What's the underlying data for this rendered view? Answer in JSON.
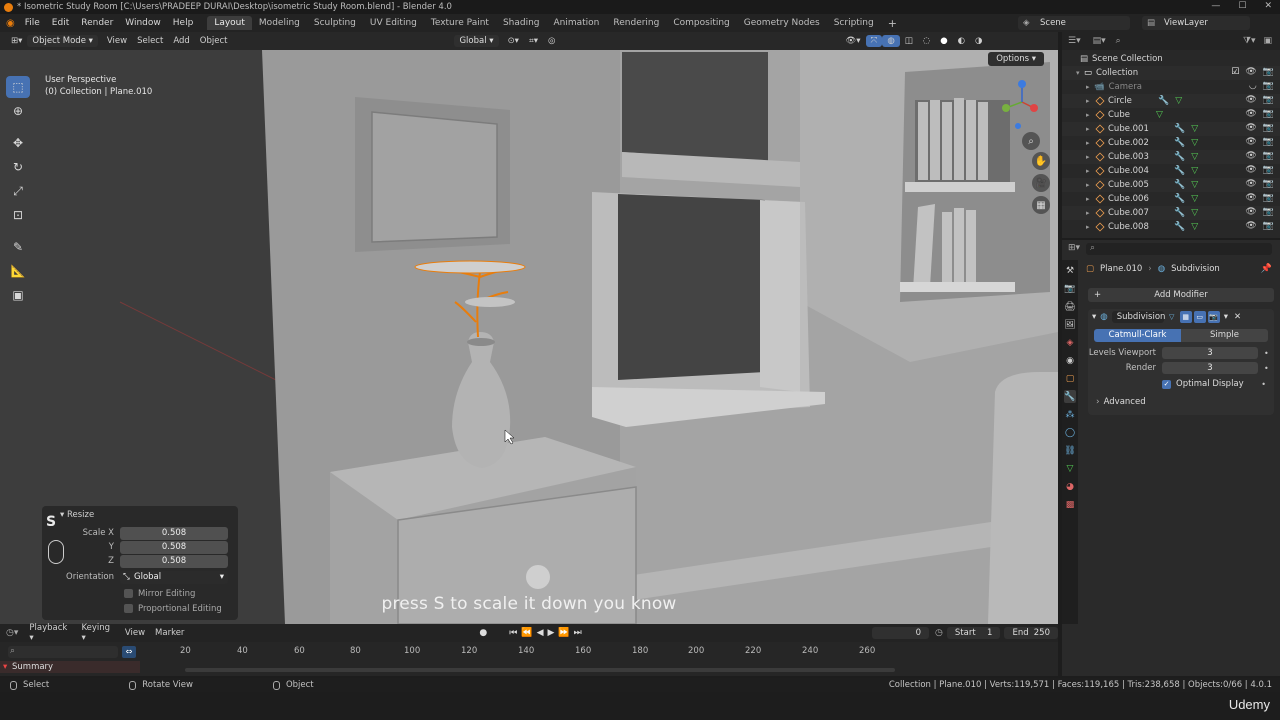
{
  "window": {
    "title": "* Isometric Study Room [C:\\Users\\PRADEEP DURAI\\Desktop\\isometric Study Room.blend] - Blender 4.0",
    "controls": [
      "—",
      "☐",
      "✕"
    ]
  },
  "menu": [
    "File",
    "Edit",
    "Render",
    "Window",
    "Help"
  ],
  "workspaces": [
    {
      "label": "Layout",
      "active": true
    },
    {
      "label": "Modeling"
    },
    {
      "label": "Sculpting"
    },
    {
      "label": "UV Editing"
    },
    {
      "label": "Texture Paint"
    },
    {
      "label": "Shading"
    },
    {
      "label": "Animation"
    },
    {
      "label": "Rendering"
    },
    {
      "label": "Compositing"
    },
    {
      "label": "Geometry Nodes"
    },
    {
      "label": "Scripting"
    }
  ],
  "scene": "Scene",
  "view_layer": "ViewLayer",
  "viewport": {
    "mode": "Object Mode",
    "menus": [
      "View",
      "Select",
      "Add",
      "Object"
    ],
    "transform_orientation": "Global",
    "perspective": "User Perspective",
    "collection_info": "(0) Collection | Plane.010",
    "options_label": "Options"
  },
  "resize_panel": {
    "title": "Resize",
    "key": "S",
    "scale_x_label": "Scale X",
    "scale_y_label": "Y",
    "scale_z_label": "Z",
    "scale_x": "0.508",
    "scale_y": "0.508",
    "scale_z": "0.508",
    "orientation_label": "Orientation",
    "orientation": "Global",
    "mirror_editing": "Mirror Editing",
    "proportional_editing": "Proportional Editing"
  },
  "subtitle": "press S to scale it down you know",
  "outliner": {
    "root": "Scene Collection",
    "collection": "Collection",
    "items": [
      "Camera",
      "Circle",
      "Cube",
      "Cube.001",
      "Cube.002",
      "Cube.003",
      "Cube.004",
      "Cube.005",
      "Cube.006",
      "Cube.007",
      "Cube.008"
    ]
  },
  "properties": {
    "object": "Plane.010",
    "modifier_context": "Subdivision",
    "add_modifier": "Add Modifier",
    "modifier_name": "Subdivision",
    "mode_catmull": "Catmull-Clark",
    "mode_simple": "Simple",
    "levels_viewport_label": "Levels Viewport",
    "levels_viewport": "3",
    "render_label": "Render",
    "render": "3",
    "optimal_display": "Optimal Display",
    "advanced": "Advanced"
  },
  "timeline": {
    "menus": [
      "Playback",
      "Keying",
      "View",
      "Marker"
    ],
    "current_frame": "0",
    "start_label": "Start",
    "start": "1",
    "end_label": "End",
    "end": "250",
    "frames": [
      "20",
      "40",
      "60",
      "80",
      "100",
      "120",
      "140",
      "160",
      "180",
      "200",
      "220",
      "240",
      "260"
    ],
    "summary": "Summary"
  },
  "statusbar": {
    "select": "Select",
    "rotate_view": "Rotate View",
    "object": "Object",
    "stats": "Collection | Plane.010 | Verts:119,571 | Faces:119,165 | Tris:238,658 | Objects:0/66 | 4.0.1"
  },
  "watermark": "Udemy",
  "colors": {
    "accent": "#4772b3",
    "selection_orange": "#e87d0d",
    "viewport_bg": "#3c3c3c"
  }
}
